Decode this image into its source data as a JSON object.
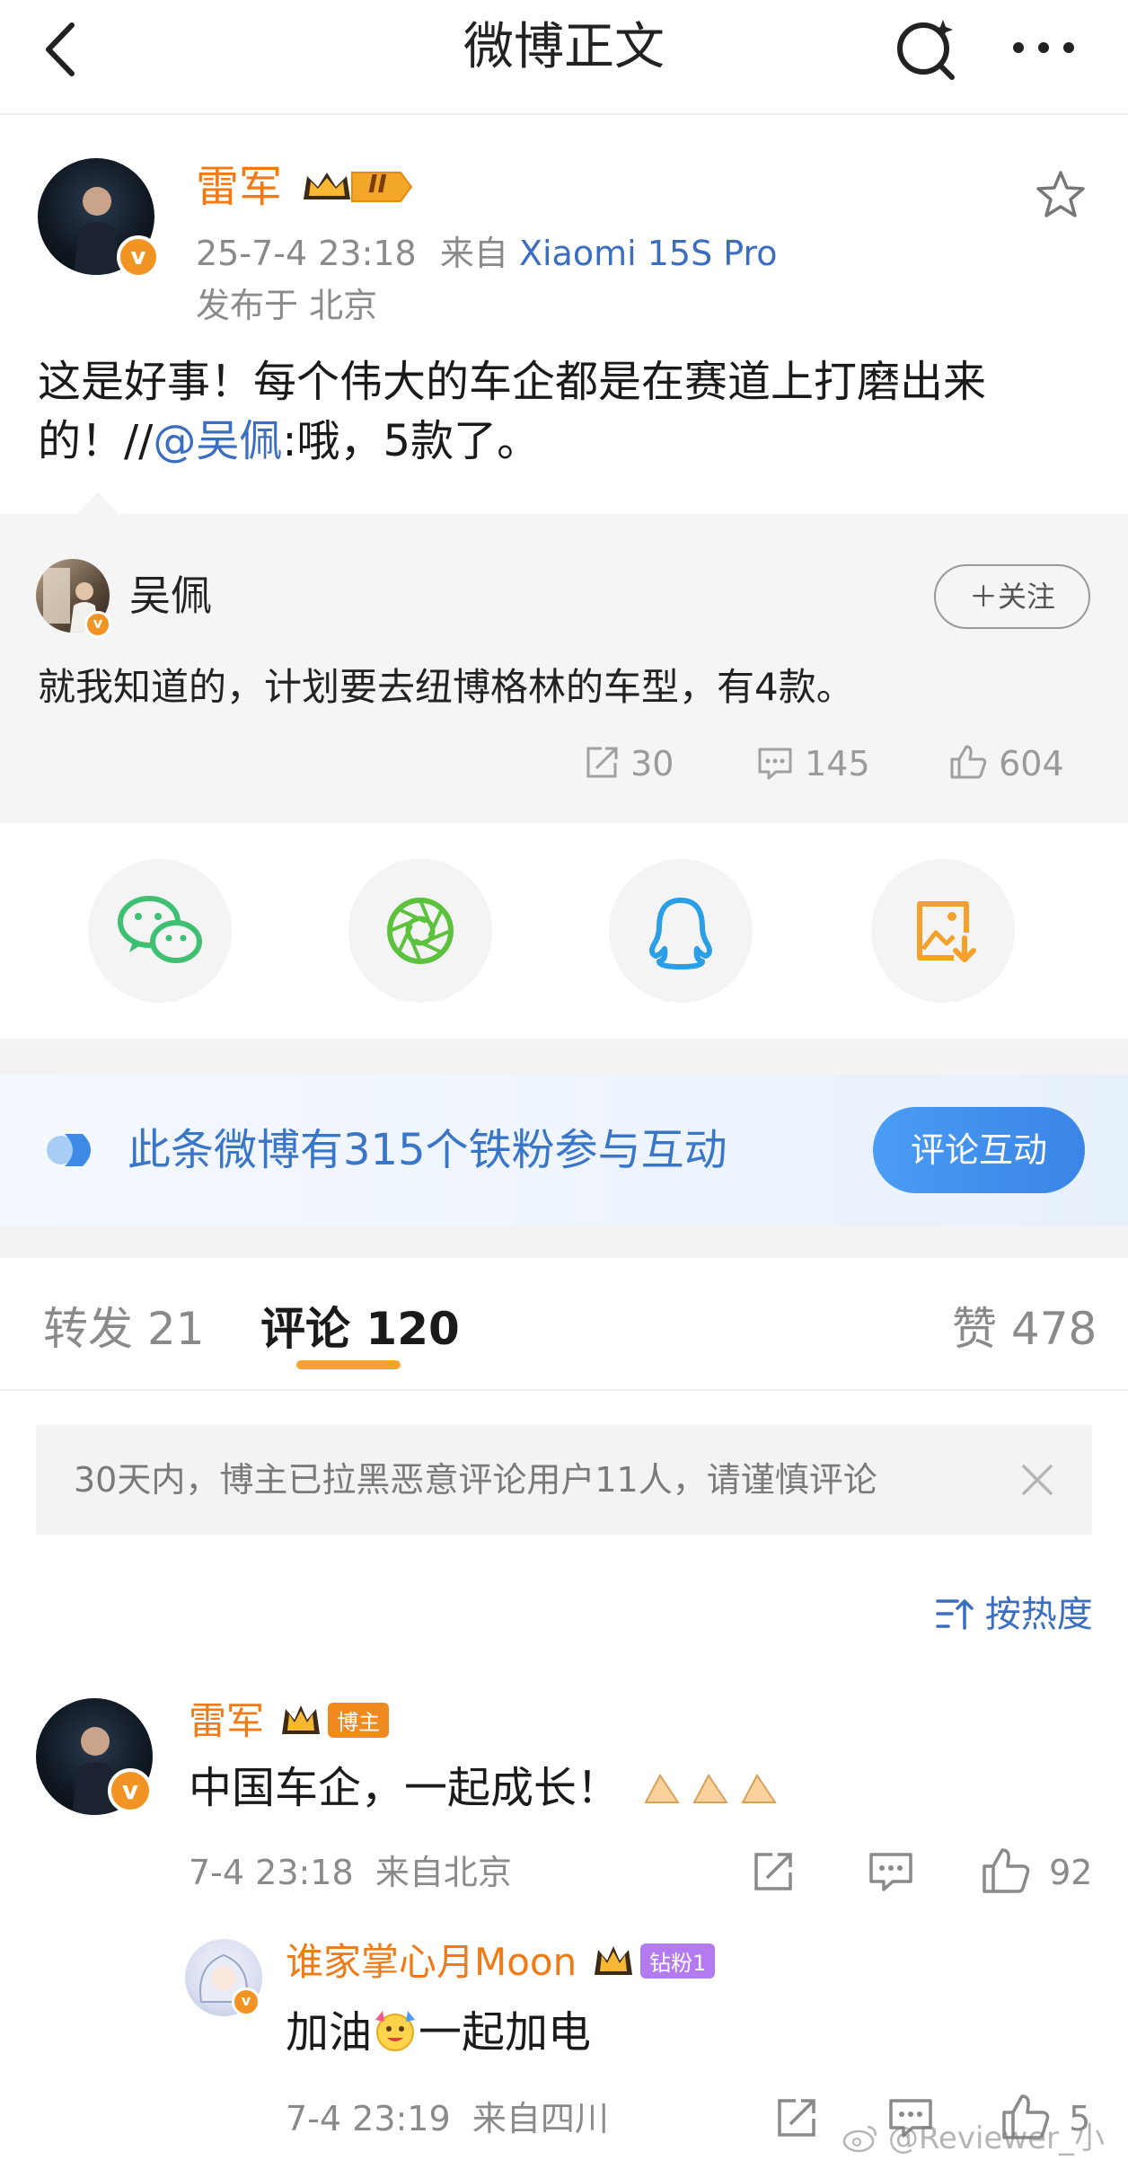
{
  "topbar": {
    "title": "微博正文",
    "back_icon": "back-arrow-icon",
    "search_icon": "search-sparkle-icon",
    "more_icon": "more-dots-icon"
  },
  "post": {
    "author": "雷军",
    "level_badge": "II",
    "time": "25-7-4 23:18",
    "source_prefix": "来自",
    "device": "Xiaomi 15S Pro",
    "location": "发布于 北京",
    "text_main": "这是好事！每个伟大的车企都是在赛道上打磨出来的！//",
    "mention": "@吴佩",
    "text_tail": ":哦，5款了。"
  },
  "quoted": {
    "author": "吴佩",
    "follow_label": "＋关注",
    "text": "就我知道的，计划要去纽博格林的车型，有4款。",
    "reposts": "30",
    "comments": "145",
    "likes": "604"
  },
  "share": {
    "wechat": "wechat-icon",
    "moments": "moments-icon",
    "qq": "qq-icon",
    "save_image": "save-image-icon"
  },
  "banner": {
    "text": "此条微博有315个铁粉参与互动",
    "button": "评论互动"
  },
  "tabs": {
    "repost": "转发 21",
    "comment": "评论 120",
    "like": "赞 478"
  },
  "notice": {
    "text": "30天内，博主已拉黑恶意评论用户11人，请谨慎评论"
  },
  "sort": {
    "label": "按热度"
  },
  "comments": [
    {
      "author": "雷军",
      "badge": "博主",
      "text": "中国车企，一起成长！",
      "time_place": "7-4 23:18  来自北京",
      "likes": "92"
    },
    {
      "author": "谁家掌心月Moon",
      "badge": "钻粉1",
      "text_a": "加油",
      "text_b": "一起加电",
      "time_place": "7-4 23:19  来自四川",
      "likes": "5"
    }
  ],
  "watermark": "@Reviewer_小康",
  "colors": {
    "orange_name": "#f07a16",
    "link_blue": "#3b6ec0",
    "tab_underline": "#f7a32e",
    "banner_button": "#3a85e6",
    "verified_badge": "#f29423"
  }
}
